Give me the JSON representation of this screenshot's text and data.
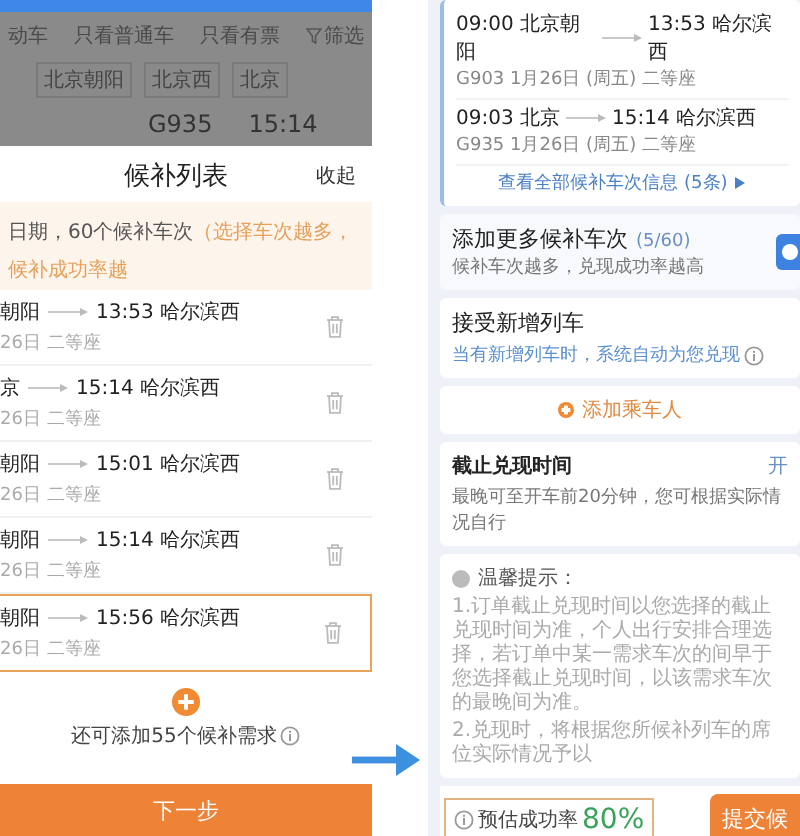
{
  "left_screen": {
    "filter_bar": [
      "动车",
      "只看普通车",
      "只看有票",
      "筛选"
    ],
    "station_chips": [
      "北京朝阳",
      "北京西",
      "北京"
    ],
    "train_peek": {
      "train": "G935",
      "time": "15:14"
    },
    "sheet": {
      "title": "候补列表",
      "collapse": "收起",
      "notice": {
        "text": "日期，60个候补车次",
        "hint": "（选择车次越多，候补成功率越"
      },
      "items": [
        {
          "from": "朝阳",
          "arrive": "13:53 哈尔滨西",
          "detail": "26日 二等座",
          "selected": false
        },
        {
          "from": "京",
          "arrive": "15:14 哈尔滨西",
          "detail": "26日 二等座",
          "selected": false
        },
        {
          "from": "朝阳",
          "arrive": "15:01 哈尔滨西",
          "detail": "26日 二等座",
          "selected": false
        },
        {
          "from": "朝阳",
          "arrive": "15:14 哈尔滨西",
          "detail": "26日 二等座",
          "selected": false
        },
        {
          "from": "朝阳",
          "arrive": "15:56 哈尔滨西",
          "detail": "26日 二等座",
          "selected": true
        }
      ],
      "add_hint": "还可添加55个候补需求",
      "next_button": "下一步"
    }
  },
  "right_screen": {
    "trains": [
      {
        "depart": "09:00 北京朝阳",
        "arrive": "13:53 哈尔滨西",
        "detail": "G903 1月26日 (周五) 二等座"
      },
      {
        "depart": "09:03 北京",
        "arrive": "15:14 哈尔滨西",
        "detail": "G935 1月26日 (周五) 二等座"
      }
    ],
    "view_all_link": "查看全部候补车次信息 (5条)",
    "add_more": {
      "title": "添加更多候补车次",
      "count": "(5/60)",
      "subtitle": "候补车次越多，兑现成功率越高"
    },
    "accept_new": {
      "title": "接受新增列车",
      "subtitle": "当有新增列车时，系统自动为您兑现"
    },
    "add_passenger": "添加乘车人",
    "deadline": {
      "title": "截止兑现时间",
      "value": "开",
      "subtitle": "最晚可至开车前20分钟，您可根据实际情况自行"
    },
    "tips": {
      "title": "温馨提示：",
      "paragraphs": [
        "1.订单截止兑现时间以您选择的截止兑现时间为准，个人出行安排合理选择，若订单中某一需求车次的间早于您选择截止兑现时间，以该需求车次的最晚间为准。",
        "2.兑现时，将根据您所候补列车的席位实际情况予以"
      ]
    },
    "success_rate": {
      "label": "预估成功率",
      "value": "80%"
    },
    "submit_button": "提交候"
  }
}
